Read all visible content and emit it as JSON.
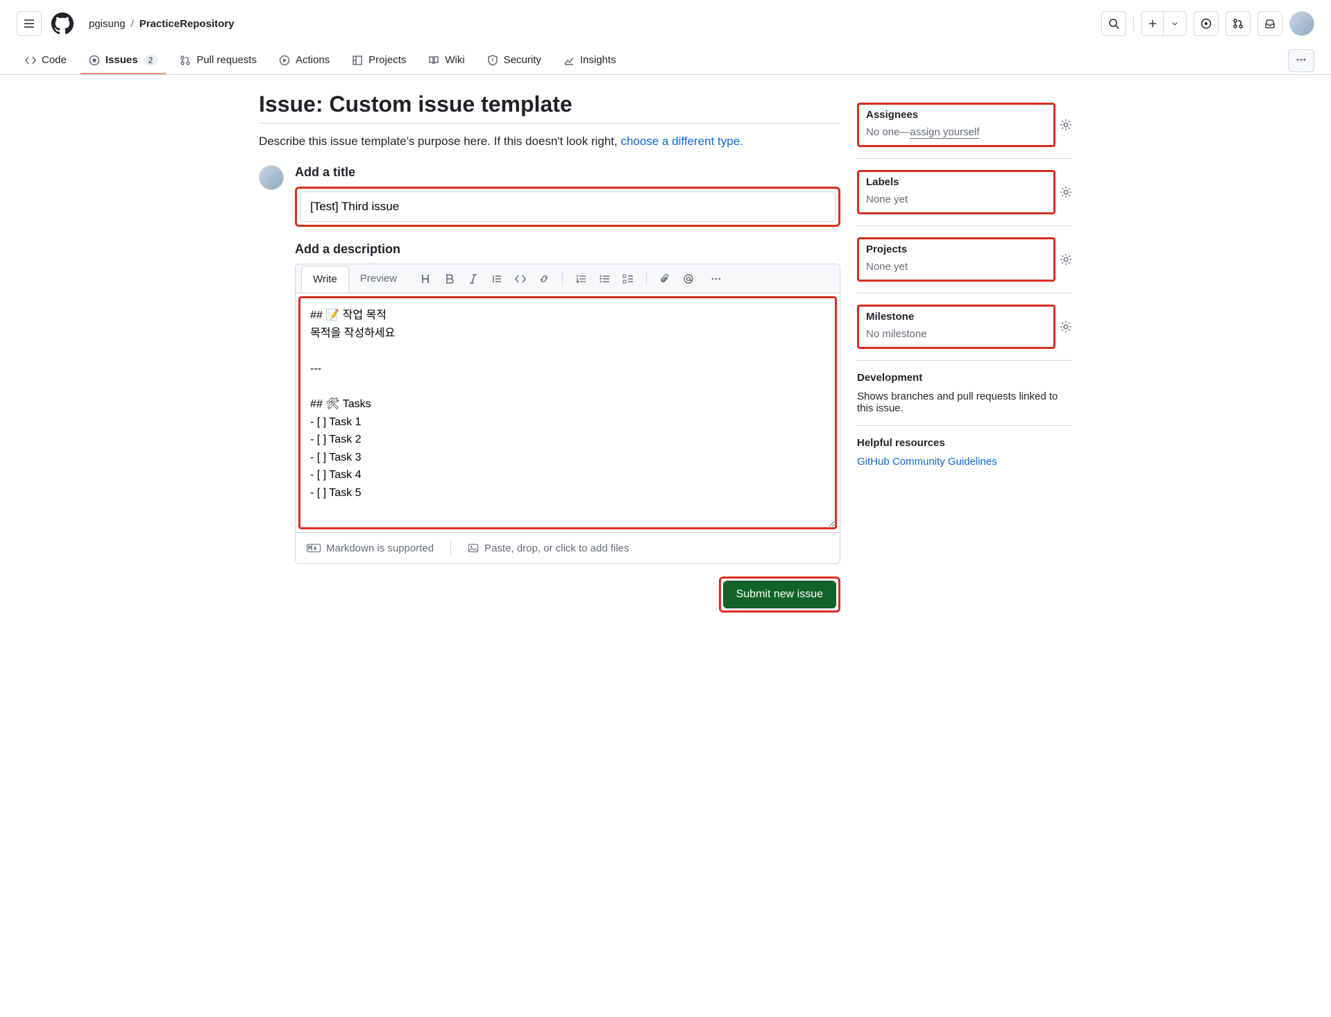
{
  "header": {
    "owner": "pgisung",
    "repo": "PracticeRepository"
  },
  "tabs": {
    "code": "Code",
    "issues": "Issues",
    "issues_count": "2",
    "pulls": "Pull requests",
    "actions": "Actions",
    "projects": "Projects",
    "wiki": "Wiki",
    "security": "Security",
    "insights": "Insights"
  },
  "page": {
    "title": "Issue: Custom issue template",
    "subtitle_prefix": "Describe this issue template's purpose here. If this doesn't look right, ",
    "subtitle_link": "choose a different type."
  },
  "form": {
    "title_label": "Add a title",
    "title_value": "[Test] Third issue",
    "desc_label": "Add a description",
    "write_tab": "Write",
    "preview_tab": "Preview",
    "desc_value": "## 📝 작업 목적\n목적을 작성하세요\n\n---\n\n## 🛠 Tasks\n- [ ] Task 1\n- [ ] Task 2\n- [ ] Task 3\n- [ ] Task 4\n- [ ] Task 5",
    "markdown_hint": "Markdown is supported",
    "paste_hint": "Paste, drop, or click to add files",
    "submit": "Submit new issue"
  },
  "sidebar": {
    "assignees": {
      "title": "Assignees",
      "prefix": "No one—",
      "link": "assign yourself"
    },
    "labels": {
      "title": "Labels",
      "value": "None yet"
    },
    "projects": {
      "title": "Projects",
      "value": "None yet"
    },
    "milestone": {
      "title": "Milestone",
      "value": "No milestone"
    },
    "development": {
      "title": "Development",
      "value": "Shows branches and pull requests linked to this issue."
    },
    "resources": {
      "title": "Helpful resources",
      "link": "GitHub Community Guidelines"
    }
  }
}
